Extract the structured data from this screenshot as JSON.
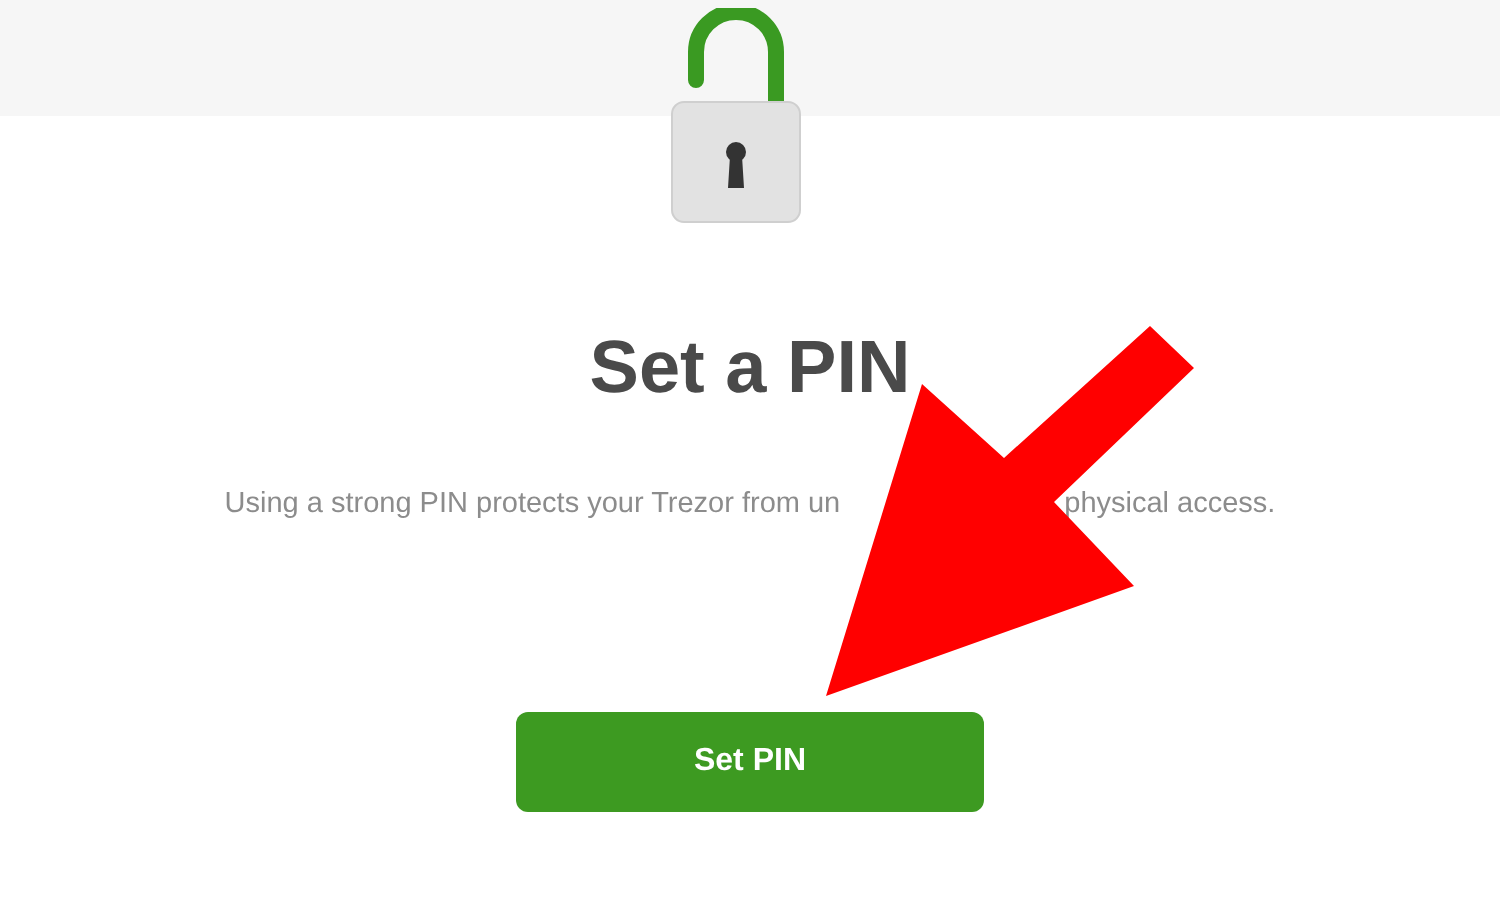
{
  "heading": "Set a PIN",
  "description_parts": [
    "Using a strong PIN protects your Trezor from un",
    "physical access."
  ],
  "button": {
    "label": "Set PIN"
  }
}
